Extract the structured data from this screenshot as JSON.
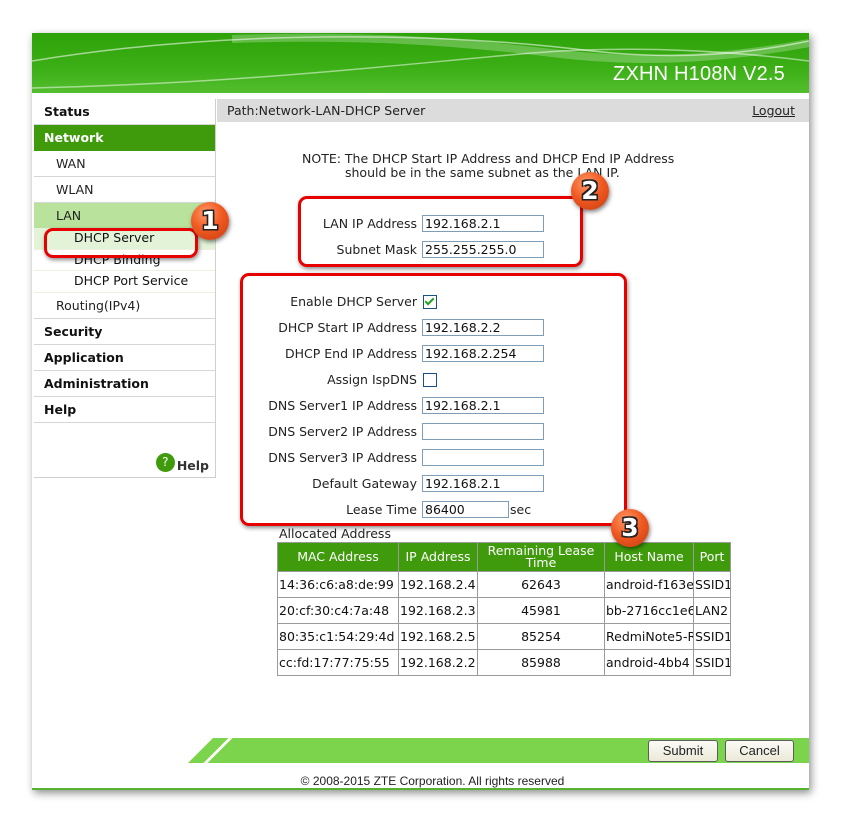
{
  "header": {
    "title": "ZXHN H108N V2.5"
  },
  "sidebar": {
    "items": [
      {
        "label": "Status"
      },
      {
        "label": "Network"
      },
      {
        "label": "WAN"
      },
      {
        "label": "WLAN"
      },
      {
        "label": "LAN"
      },
      {
        "label": "DHCP Server"
      },
      {
        "label": "DHCP Binding"
      },
      {
        "label": "DHCP Port Service"
      },
      {
        "label": "Routing(IPv4)"
      },
      {
        "label": "Security"
      },
      {
        "label": "Application"
      },
      {
        "label": "Administration"
      },
      {
        "label": "Help"
      }
    ],
    "help_link": "Help",
    "help_icon": "?"
  },
  "pathbar": {
    "path": "Path:Network-LAN-DHCP Server",
    "logout": "Logout"
  },
  "note": {
    "line1": "NOTE: The DHCP Start IP Address and DHCP End IP Address",
    "line2": "should be in the same subnet as the LAN IP."
  },
  "lan": {
    "ip_label": "LAN IP Address",
    "ip_value": "192.168.2.1",
    "mask_label": "Subnet Mask",
    "mask_value": "255.255.255.0"
  },
  "dhcp": {
    "enable_label": "Enable DHCP Server",
    "enable_checked": true,
    "start_label": "DHCP Start IP Address",
    "start_value": "192.168.2.2",
    "end_label": "DHCP End IP Address",
    "end_value": "192.168.2.254",
    "ispdns_label": "Assign IspDNS",
    "ispdns_checked": false,
    "dns1_label": "DNS Server1 IP Address",
    "dns1_value": "192.168.2.1",
    "dns2_label": "DNS Server2 IP Address",
    "dns2_value": "",
    "dns3_label": "DNS Server3 IP Address",
    "dns3_value": "",
    "gateway_label": "Default Gateway",
    "gateway_value": "192.168.2.1",
    "lease_label": "Lease Time",
    "lease_value": "86400",
    "lease_unit": "sec"
  },
  "allocated": {
    "title": "Allocated Address",
    "columns": [
      "MAC Address",
      "IP Address",
      "Remaining Lease Time",
      "Host Name",
      "Port"
    ],
    "rows": [
      [
        "14:36:c6:a8:de:99",
        "192.168.2.4",
        "62643",
        "android-f163e",
        "SSID1"
      ],
      [
        "20:cf:30:c4:7a:48",
        "192.168.2.3",
        "45981",
        "bb-2716cc1e6",
        "LAN2"
      ],
      [
        "80:35:c1:54:29:4d",
        "192.168.2.5",
        "85254",
        "RedmiNote5-R",
        "SSID1"
      ],
      [
        "cc:fd:17:77:75:55",
        "192.168.2.2",
        "85988",
        "android-4bb4",
        "SSID1"
      ]
    ]
  },
  "buttons": {
    "submit": "Submit",
    "cancel": "Cancel"
  },
  "footer": {
    "copyright": "© 2008-2015 ZTE Corporation. All rights reserved"
  },
  "annotations": {
    "badge1": "1",
    "badge2": "2",
    "badge3": "3"
  },
  "colors": {
    "brand_green": "#3f9b0b",
    "annotation_red": "#e60000",
    "badge_orange": "#f05a22"
  }
}
